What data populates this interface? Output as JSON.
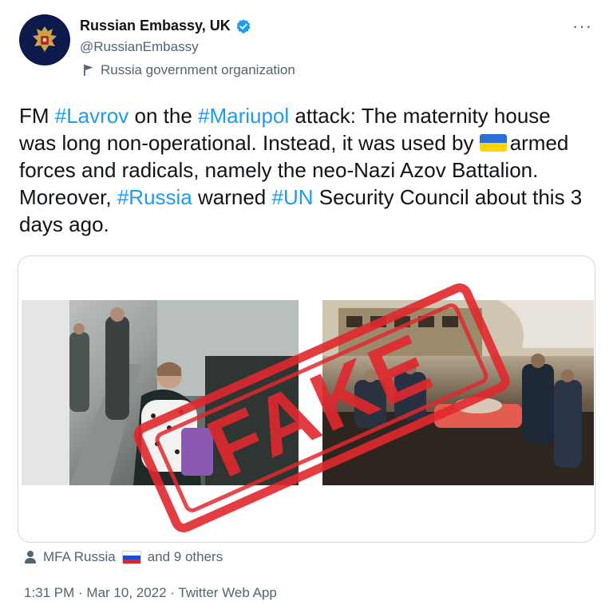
{
  "account": {
    "name": "Russian Embassy, UK",
    "handle": "@RussianEmbassy",
    "label": "Russia government organization"
  },
  "tweet": {
    "p1": "FM ",
    "tag_lavrov": "#Lavrov",
    "p2": " on the ",
    "tag_mariupol": "#Mariupol",
    "p3": " attack: The maternity house was long non-operational. Instead, it was used by ",
    "p4": "armed forces and radicals, namely the neo-Nazi Azov Battalion. Moreover, ",
    "tag_russia": "#Russia",
    "p5": " warned ",
    "tag_un": "#UN",
    "p6": " Security Council about this 3 days ago."
  },
  "media": {
    "stamp_text": "FAKE"
  },
  "social": {
    "liker": "MFA Russia",
    "others": "and 9 others"
  },
  "meta": {
    "timestamp": "1:31 PM · Mar 10, 2022 · Twitter Web App"
  },
  "icons": {
    "verified": "verified-badge-icon",
    "gov": "flag-icon",
    "more": "more-icon",
    "person": "person-icon"
  },
  "colors": {
    "link": "#1d9bf0",
    "stamp": "#e0282e",
    "verified": "#1d9bf0"
  }
}
